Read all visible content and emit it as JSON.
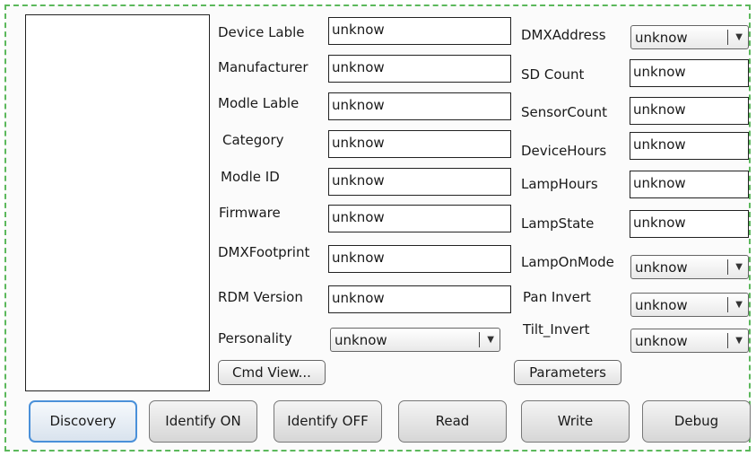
{
  "left": {
    "labels": [
      "Device Lable",
      "Manufacturer",
      "Modle Lable",
      "Category",
      "Modle ID",
      "Firmware",
      "DMXFootprint",
      "RDM Version",
      "Personality"
    ],
    "values": [
      "unknow",
      "unknow",
      "unknow",
      "unknow",
      "unknow",
      "unknow",
      "unknow",
      "unknow"
    ],
    "personality_value": "unknow",
    "cmd_view_label": "Cmd View..."
  },
  "right": {
    "labels": [
      "DMXAddress",
      "SD Count",
      "SensorCount",
      "DeviceHours",
      "LampHours",
      "LampState",
      "LampOnMode",
      "Pan Invert",
      "Tilt_Invert"
    ],
    "dmx_address_value": "unknow",
    "values": [
      "unknow",
      "unknow",
      "unknow",
      "unknow",
      "unknow"
    ],
    "lamp_on_mode_value": "unknow",
    "pan_invert_value": "unknow",
    "tilt_invert_value": "unknow",
    "parameters_label": "Parameters"
  },
  "buttons": {
    "discovery": "Discovery",
    "identify_on": "Identify ON",
    "identify_off": "Identify OFF",
    "read": "Read",
    "write": "Write",
    "debug": "Debug"
  },
  "icons": {
    "dropdown": "chevron-down-icon"
  },
  "colors": {
    "frame_border": "#5cb85c",
    "focus": "#4a90d9"
  }
}
